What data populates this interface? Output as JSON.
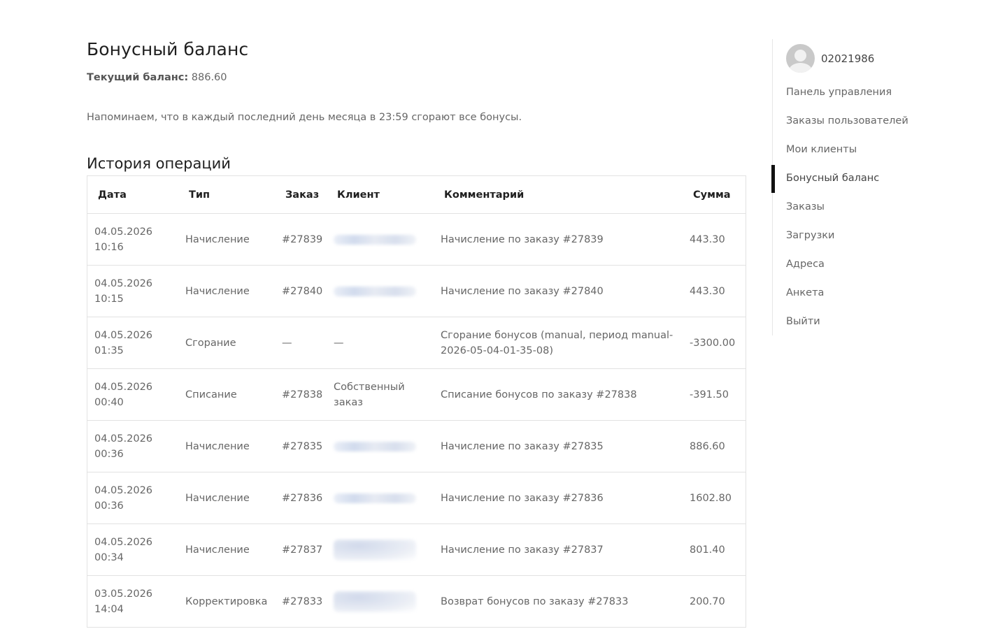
{
  "page": {
    "title": "Бонусный баланс",
    "balance_label": "Текущий баланс:",
    "balance_value": "886.60",
    "reminder": "Напоминаем, что в каждый последний день месяца в 23:59 сгорают все бонусы.",
    "history_title": "История операций"
  },
  "table": {
    "headers": [
      "Дата",
      "Тип",
      "Заказ",
      "Клиент",
      "Комментарий",
      "Сумма"
    ],
    "rows": [
      {
        "date": "04.05.2026",
        "time": "10:16",
        "type": "Начисление",
        "order": "#27839",
        "client": "",
        "comment": "Начисление по заказу #27839",
        "amount": "443.30"
      },
      {
        "date": "04.05.2026",
        "time": "10:15",
        "type": "Начисление",
        "order": "#27840",
        "client": "",
        "comment": "Начисление по заказу #27840",
        "amount": "443.30"
      },
      {
        "date": "04.05.2026",
        "time": "01:35",
        "type": "Сгорание",
        "order": "—",
        "client": "—",
        "comment": "Сгорание бонусов (manual, период manual-2026-05-04-01-35-08)",
        "amount": "-3300.00"
      },
      {
        "date": "04.05.2026",
        "time": "00:40",
        "type": "Списание",
        "order": "#27838",
        "client": "Собственный заказ",
        "comment": "Списание бонусов по заказу #27838",
        "amount": "-391.50"
      },
      {
        "date": "04.05.2026",
        "time": "00:36",
        "type": "Начисление",
        "order": "#27835",
        "client": "",
        "comment": "Начисление по заказу #27835",
        "amount": "886.60"
      },
      {
        "date": "04.05.2026",
        "time": "00:36",
        "type": "Начисление",
        "order": "#27836",
        "client": "",
        "comment": "Начисление по заказу #27836",
        "amount": "1602.80"
      },
      {
        "date": "04.05.2026",
        "time": "00:34",
        "type": "Начисление",
        "order": "#27837",
        "client": "",
        "comment": "Начисление по заказу #27837",
        "amount": "801.40"
      },
      {
        "date": "03.05.2026",
        "time": "14:04",
        "type": "Корректировка",
        "order": "#27833",
        "client": "",
        "comment": "Возврат бонусов по заказу #27833",
        "amount": "200.70"
      }
    ]
  },
  "sidebar": {
    "username": "02021986",
    "items": [
      {
        "label": "Панель управления"
      },
      {
        "label": "Заказы пользователей"
      },
      {
        "label": "Мои клиенты"
      },
      {
        "label": "Бонусный баланс"
      },
      {
        "label": "Заказы"
      },
      {
        "label": "Загрузки"
      },
      {
        "label": "Адреса"
      },
      {
        "label": "Анкета"
      },
      {
        "label": "Выйти"
      }
    ]
  }
}
